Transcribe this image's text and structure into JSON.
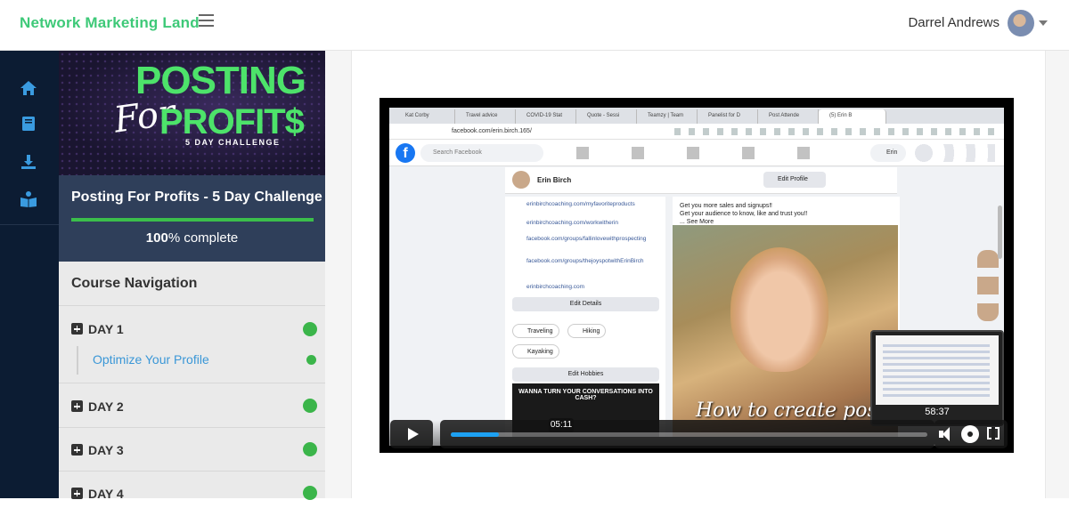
{
  "header": {
    "brand": "Network Marketing Land",
    "user_name": "Darrel Andrews"
  },
  "sidebar_icons": [
    "home-icon",
    "book-icon",
    "download-icon",
    "reader-icon"
  ],
  "course": {
    "cover_line1": "POSTING",
    "cover_line2": "For",
    "cover_line3": "PROFIT$",
    "cover_line4": "5 DAY CHALLENGE",
    "title": "Posting For Profits - 5 Day Challenge",
    "progress_value": "100",
    "progress_suffix": "% complete",
    "progress_fraction": 1.0
  },
  "navigation": {
    "heading": "Course Navigation",
    "days": [
      {
        "label": "DAY 1",
        "lesson": "Optimize Your Profile"
      },
      {
        "label": "DAY 2"
      },
      {
        "label": "DAY 3"
      },
      {
        "label": "DAY 4"
      }
    ]
  },
  "video": {
    "browser_tabs": [
      "Kat Corby",
      "Travel advice",
      "COVID-19 Stat",
      "Quote - Sessi",
      "Teamzy | Team",
      "Panelist for D",
      "Post Attende",
      "(5) Erin B"
    ],
    "url": "facebook.com/erin.birch.165/",
    "fb_search_placeholder": "Search Facebook",
    "fb_user": "Erin",
    "profile_name": "Erin Birch",
    "edit_profile": "Edit Profile",
    "links": [
      "erinbirchcoaching.com/myfavoriteproducts",
      "erinbirchcoaching.com/workwitherin",
      "facebook.com/groups/fallinlovewithprospecting",
      "facebook.com/groups/thejoyspotwithErinBirch",
      "erinbirchcoaching.com"
    ],
    "edit_details": "Edit Details",
    "hobbies": [
      "Traveling",
      "Hiking",
      "Kayaking"
    ],
    "edit_hobbies": "Edit Hobbies",
    "promo_text": "WANNA TURN YOUR CONVERSATIONS INTO CASH?",
    "post_line1": "Get you more sales and signups‼",
    "post_line2": "Get your audience to know, like and trust you‼",
    "post_more": "... See More",
    "caption": "How to create posts",
    "pip_time": "58:37",
    "hover_time": "05:11",
    "progress_fraction": 0.1
  }
}
